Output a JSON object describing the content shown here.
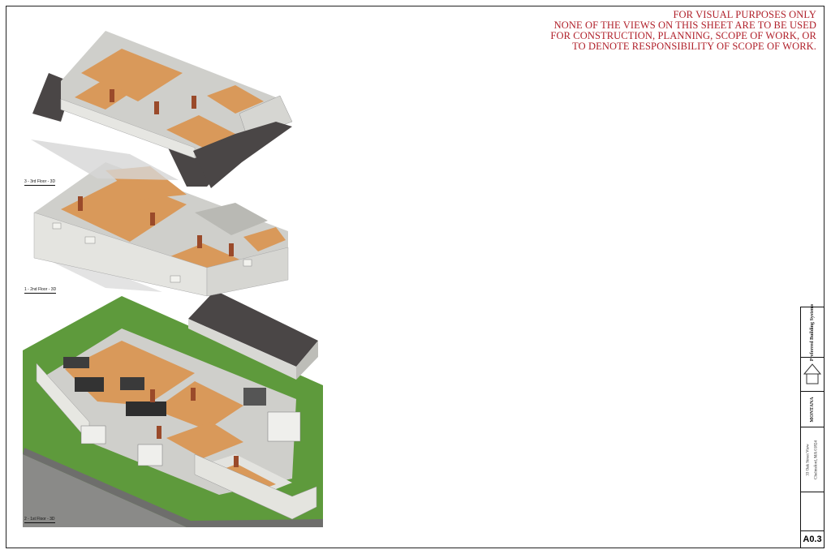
{
  "disclaimer": [
    "FOR VISUAL PURPOSES ONLY",
    "NONE OF THE VIEWS ON THIS SHEET ARE TO BE USED",
    "FOR CONSTRUCTION, PLANNING, SCOPE OF WORK, OR",
    "TO DENOTE RESPONSIBILITY OF SCOPE OF WORK."
  ],
  "views": {
    "third_floor": "3 - 3rd Floor - 3D",
    "second_floor": "1 - 2nd Floor - 3D",
    "first_floor": "2 - 1st Floor - 3D"
  },
  "title_block": {
    "company": "Preferred Building Systems",
    "logo_text": "MONTANA",
    "project_line1": "33 Oak Street View",
    "project_line2": "Chelmsford, MA 01824",
    "sheet_number": "A0.3"
  },
  "colors": {
    "disclaimer_red": "#b0202a",
    "floor_wood": "#d9995a",
    "wall_grey": "#c8c8c4",
    "roof_dark": "#4a4646",
    "grass_green": "#5e9a3c"
  }
}
